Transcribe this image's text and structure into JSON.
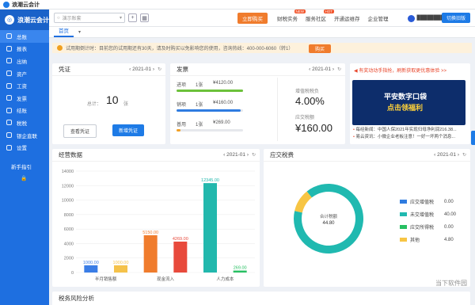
{
  "app": {
    "title": "浪潮云会计"
  },
  "sidebar": {
    "brand": "浪潮云会计",
    "items": [
      {
        "label": "总账",
        "icon": "ledger-icon"
      },
      {
        "label": "报表",
        "icon": "report-icon"
      },
      {
        "label": "出纳",
        "icon": "cashier-icon"
      },
      {
        "label": "资产",
        "icon": "asset-icon"
      },
      {
        "label": "工资",
        "icon": "salary-icon"
      },
      {
        "label": "发票",
        "icon": "invoice-icon"
      },
      {
        "label": "结账",
        "icon": "checkout-icon"
      },
      {
        "label": "税税",
        "icon": "tax-icon"
      },
      {
        "label": "银企直联",
        "icon": "bank-icon"
      },
      {
        "label": "设置",
        "icon": "settings-icon"
      }
    ],
    "guide": "新手指引"
  },
  "topbar": {
    "search_placeholder": "演示账套",
    "buy": "立即购买",
    "links": [
      {
        "label": "财税实务",
        "badge": "NEW"
      },
      {
        "label": "服务社区",
        "badge": "HOT"
      },
      {
        "label": "开通运维存",
        "badge": ""
      },
      {
        "label": "企业管理",
        "badge": ""
      }
    ],
    "user": "████████",
    "switch": "切换旧版"
  },
  "tabs": {
    "home": "首页",
    "dropdown": "▾"
  },
  "notice": {
    "text": "试用期倒计时：目前您的试用期还有30天，请及时购买以免影响您的使用，咨询热线：400-000-6060（转1）",
    "button": "购买"
  },
  "voucher": {
    "title": "凭证",
    "period": "2021-01",
    "total_label": "总计：",
    "total_value": "10",
    "unit": "张",
    "view_btn": "查看凭证",
    "new_btn": "新增凭证"
  },
  "invoice": {
    "title": "发票",
    "period": "2021-01",
    "rows": [
      {
        "name": "进项",
        "count": "1张",
        "amount": "¥4120.00",
        "color": "#6cc13a",
        "fill": 1.0
      },
      {
        "name": "销项",
        "count": "1张",
        "amount": "¥4160.00",
        "color": "#2f7ce0",
        "fill": 0.97
      },
      {
        "name": "普用",
        "count": "1张",
        "amount": "¥269.00",
        "color": "#f2a024",
        "fill": 0.06
      }
    ],
    "tax_rate_label": "增值税税负",
    "tax_rate": "4.00%",
    "tax_due_label": "应交税额",
    "tax_due": "¥160.00"
  },
  "news": {
    "headline": "有奖动动手指抢，刷新获取更优惠体验 >>",
    "banner_title": "平安数字口袋",
    "banner_sub": "点击领福利",
    "items": [
      {
        "tag": "每经新闻：",
        "text": "中国人保2021年实现归母净利润216.38..."
      },
      {
        "tag": "易云资讯：",
        "text": "小微企业老板注意！一好一坏两个消息..."
      }
    ]
  },
  "biz": {
    "title": "经营数据",
    "period": "2021-01"
  },
  "tax": {
    "title": "应交税费",
    "period": "2021-01",
    "center_label": "合计税额",
    "center_value": "44.80",
    "legend": [
      {
        "name": "应交增值税",
        "value": "0.00",
        "color": "#2f7ce0"
      },
      {
        "name": "未交增值税",
        "value": "40.00",
        "color": "#20b9b0"
      },
      {
        "name": "应交所得税",
        "value": "0.00",
        "color": "#27c062"
      },
      {
        "name": "其他",
        "value": "4.80",
        "color": "#f7c544"
      }
    ]
  },
  "risk": {
    "title": "税务风险分析"
  },
  "watermark": "当下软件园",
  "chart_data": [
    {
      "type": "bar",
      "title": "经营数据",
      "categories": [
        "半月销售额",
        "",
        "现金流入",
        "",
        "人力成本",
        ""
      ],
      "values": [
        1000.0,
        1000.0,
        5150.0,
        4269.0,
        12345.0,
        269.0
      ],
      "value_labels": [
        "1000.00",
        "1000.00",
        "5150.00",
        "4269.00",
        "12345.00",
        "269.00"
      ],
      "bar_colors": [
        "#3a7de6",
        "#f5c24a",
        "#f07c2d",
        "#e84a3c",
        "#22b8ad",
        "#27c062"
      ],
      "ylim": [
        0,
        14000
      ],
      "yticks": [
        0,
        2000,
        4000,
        6000,
        8000,
        10000,
        12000,
        14000
      ]
    },
    {
      "type": "pie",
      "title": "应交税费",
      "labels": [
        "应交增值税",
        "未交增值税",
        "应交所得税",
        "其他"
      ],
      "values": [
        0.0,
        40.0,
        0.0,
        4.8
      ]
    }
  ]
}
